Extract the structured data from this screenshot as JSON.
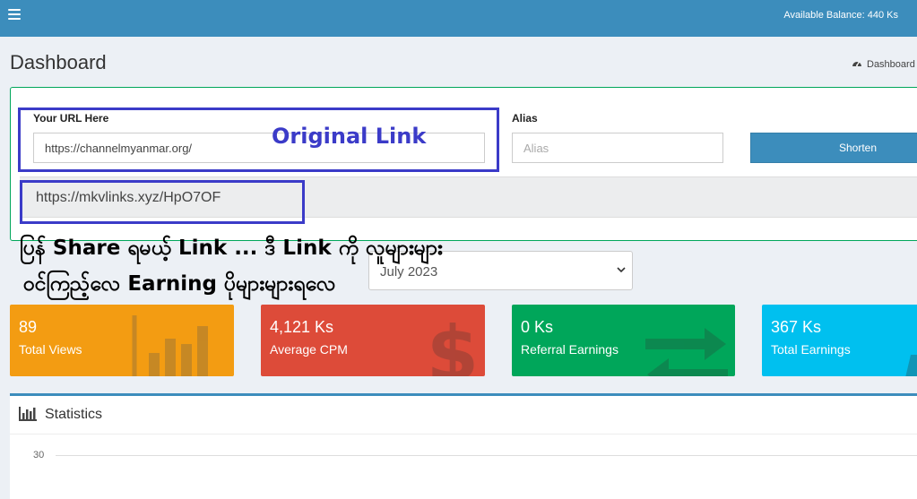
{
  "topbar": {
    "balance_text": "Available Balance: 440 Ks"
  },
  "page": {
    "title": "Dashboard",
    "breadcrumb": "Dashboard"
  },
  "shortener": {
    "url_label": "Your URL Here",
    "url_value": "https://channelmyanmar.org/",
    "alias_label": "Alias",
    "alias_placeholder": "Alias",
    "shorten_label": "Shorten",
    "result_link": "https://mkvlinks.xyz/HpO7OF"
  },
  "annotations": {
    "original_link": "Original Link",
    "line1": "ပြန် Share ရမယ့် Link ... ဒီ Link ကို လူများများ",
    "line2": "ဝင်ကြည့်လေ  Earning ပိုများများရလေ"
  },
  "month_select": {
    "selected": "July 2023"
  },
  "cards": [
    {
      "value": "89",
      "label": "Total Views",
      "color": "#f39c12",
      "icon": "bar-chart-icon"
    },
    {
      "value": "4,121 Ks",
      "label": "Average CPM",
      "color": "#dd4b39",
      "icon": "dollar-icon"
    },
    {
      "value": "0 Ks",
      "label": "Referral Earnings",
      "color": "#00a65a",
      "icon": "exchange-icon"
    },
    {
      "value": "367 Ks",
      "label": "Total Earnings",
      "color": "#00c0ef",
      "icon": "money-icon"
    }
  ],
  "statistics": {
    "title": "Statistics",
    "y_tick": "30"
  }
}
